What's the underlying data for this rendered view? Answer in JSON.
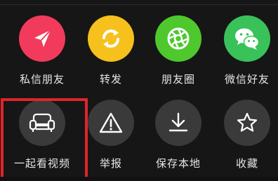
{
  "share_row": [
    {
      "label": "私信朋友",
      "icon": "send-icon",
      "color": "#f23b5c"
    },
    {
      "label": "转发",
      "icon": "repost-icon",
      "color": "#f6c11c"
    },
    {
      "label": "朋友圈",
      "icon": "moments-icon",
      "color": "#4fc82d"
    },
    {
      "label": "微信好友",
      "icon": "wechat-icon",
      "color": "#3ac25a"
    }
  ],
  "action_row": [
    {
      "label": "一起看视频",
      "icon": "sofa-icon"
    },
    {
      "label": "举报",
      "icon": "warning-icon"
    },
    {
      "label": "保存本地",
      "icon": "download-icon"
    },
    {
      "label": "收藏",
      "icon": "star-icon"
    }
  ],
  "highlight_color": "#e0242a"
}
